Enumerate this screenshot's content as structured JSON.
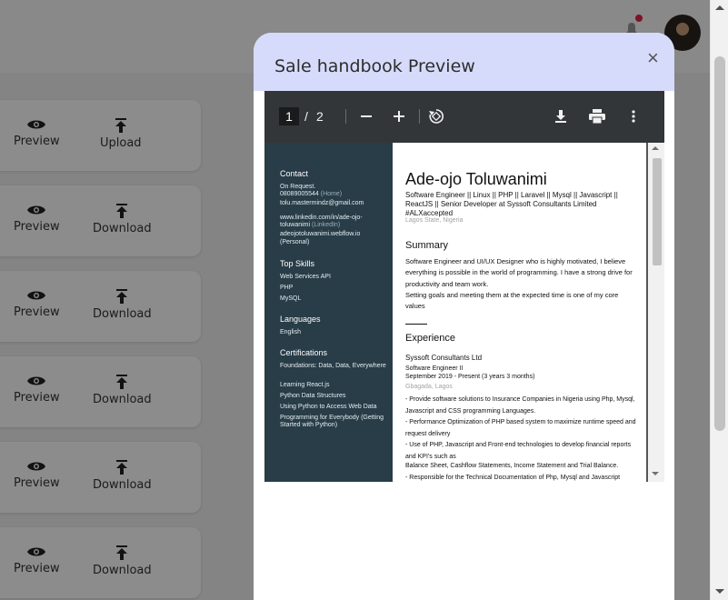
{
  "background": {
    "cards": [
      {
        "preview": "Preview",
        "action": "Upload"
      },
      {
        "preview": "Preview",
        "action": "Download"
      },
      {
        "preview": "Preview",
        "action": "Download"
      },
      {
        "preview": "Preview",
        "action": "Download"
      },
      {
        "preview": "Preview",
        "action": "Download"
      },
      {
        "preview": "Preview",
        "action": "Download"
      }
    ]
  },
  "modal": {
    "title": "Sale handbook Preview",
    "close": "×"
  },
  "pdf_toolbar": {
    "current_page": "1",
    "separator": "/",
    "total_pages": "2"
  },
  "resume": {
    "sidebar": {
      "contact_heading": "Contact",
      "contact_on_request": "On Request.",
      "phone": "08089005544",
      "phone_label": "(Home)",
      "email": "tolu.mastermindz@gmail.com",
      "linkedin": "www.linkedin.com/in/ade-ojo-toluwanimi",
      "linkedin_label": "(LinkedIn)",
      "website": "adeojotoluwanimi.webflow.io",
      "website_label": "(Personal)",
      "skills_heading": "Top Skills",
      "skills": [
        "Web Services API",
        "PHP",
        "MySQL"
      ],
      "languages_heading": "Languages",
      "languages": [
        "English"
      ],
      "certifications_heading": "Certifications",
      "certifications": [
        "Foundations: Data, Data, Everywhere",
        "Learning React.js",
        "Python Data Structures",
        "Using Python to Access Web Data",
        "Programming for Everybody (Getting Started with Python)"
      ]
    },
    "name": "Ade-ojo Toluwanimi",
    "headline": "Software Engineer || Linux || PHP || Laravel || Mysql || Javascript || ReactJS || Senior Developer at Syssoft Consultants Limited #ALXaccepted",
    "location": "Lagos State, Nigeria",
    "summary_heading": "Summary",
    "summary_1": "Software Engineer and UI/UX Designer who is highly motivated, I believe everything is possible in the world of programming. I have a strong drive for productivity and team work.",
    "summary_2": "Setting goals and meeting them at the expected time is one of my core values",
    "experience_heading": "Experience",
    "company": "Syssoft Consultants Ltd",
    "role": "Software Engineer II",
    "period": "September 2019 - Present (3 years 3 months)",
    "place": "Gbagada, Lagos",
    "bullets": [
      "- Provide software solutions to Insurance Companies in Nigeria using Php, Mysql, Javascript and CSS programming Languages.",
      "- Performance Optimization of PHP based system to maximize runtime speed and request delivery",
      "- Use of PHP, Javascript and Front-end technologies to develop financial reports and KPI's such as",
      "Balance Sheet, Cashflow Statements, Income Statement and Trial Balance.",
      "- Responsible for the Technical Documentation of Php, Mysql and Javascript"
    ]
  }
}
